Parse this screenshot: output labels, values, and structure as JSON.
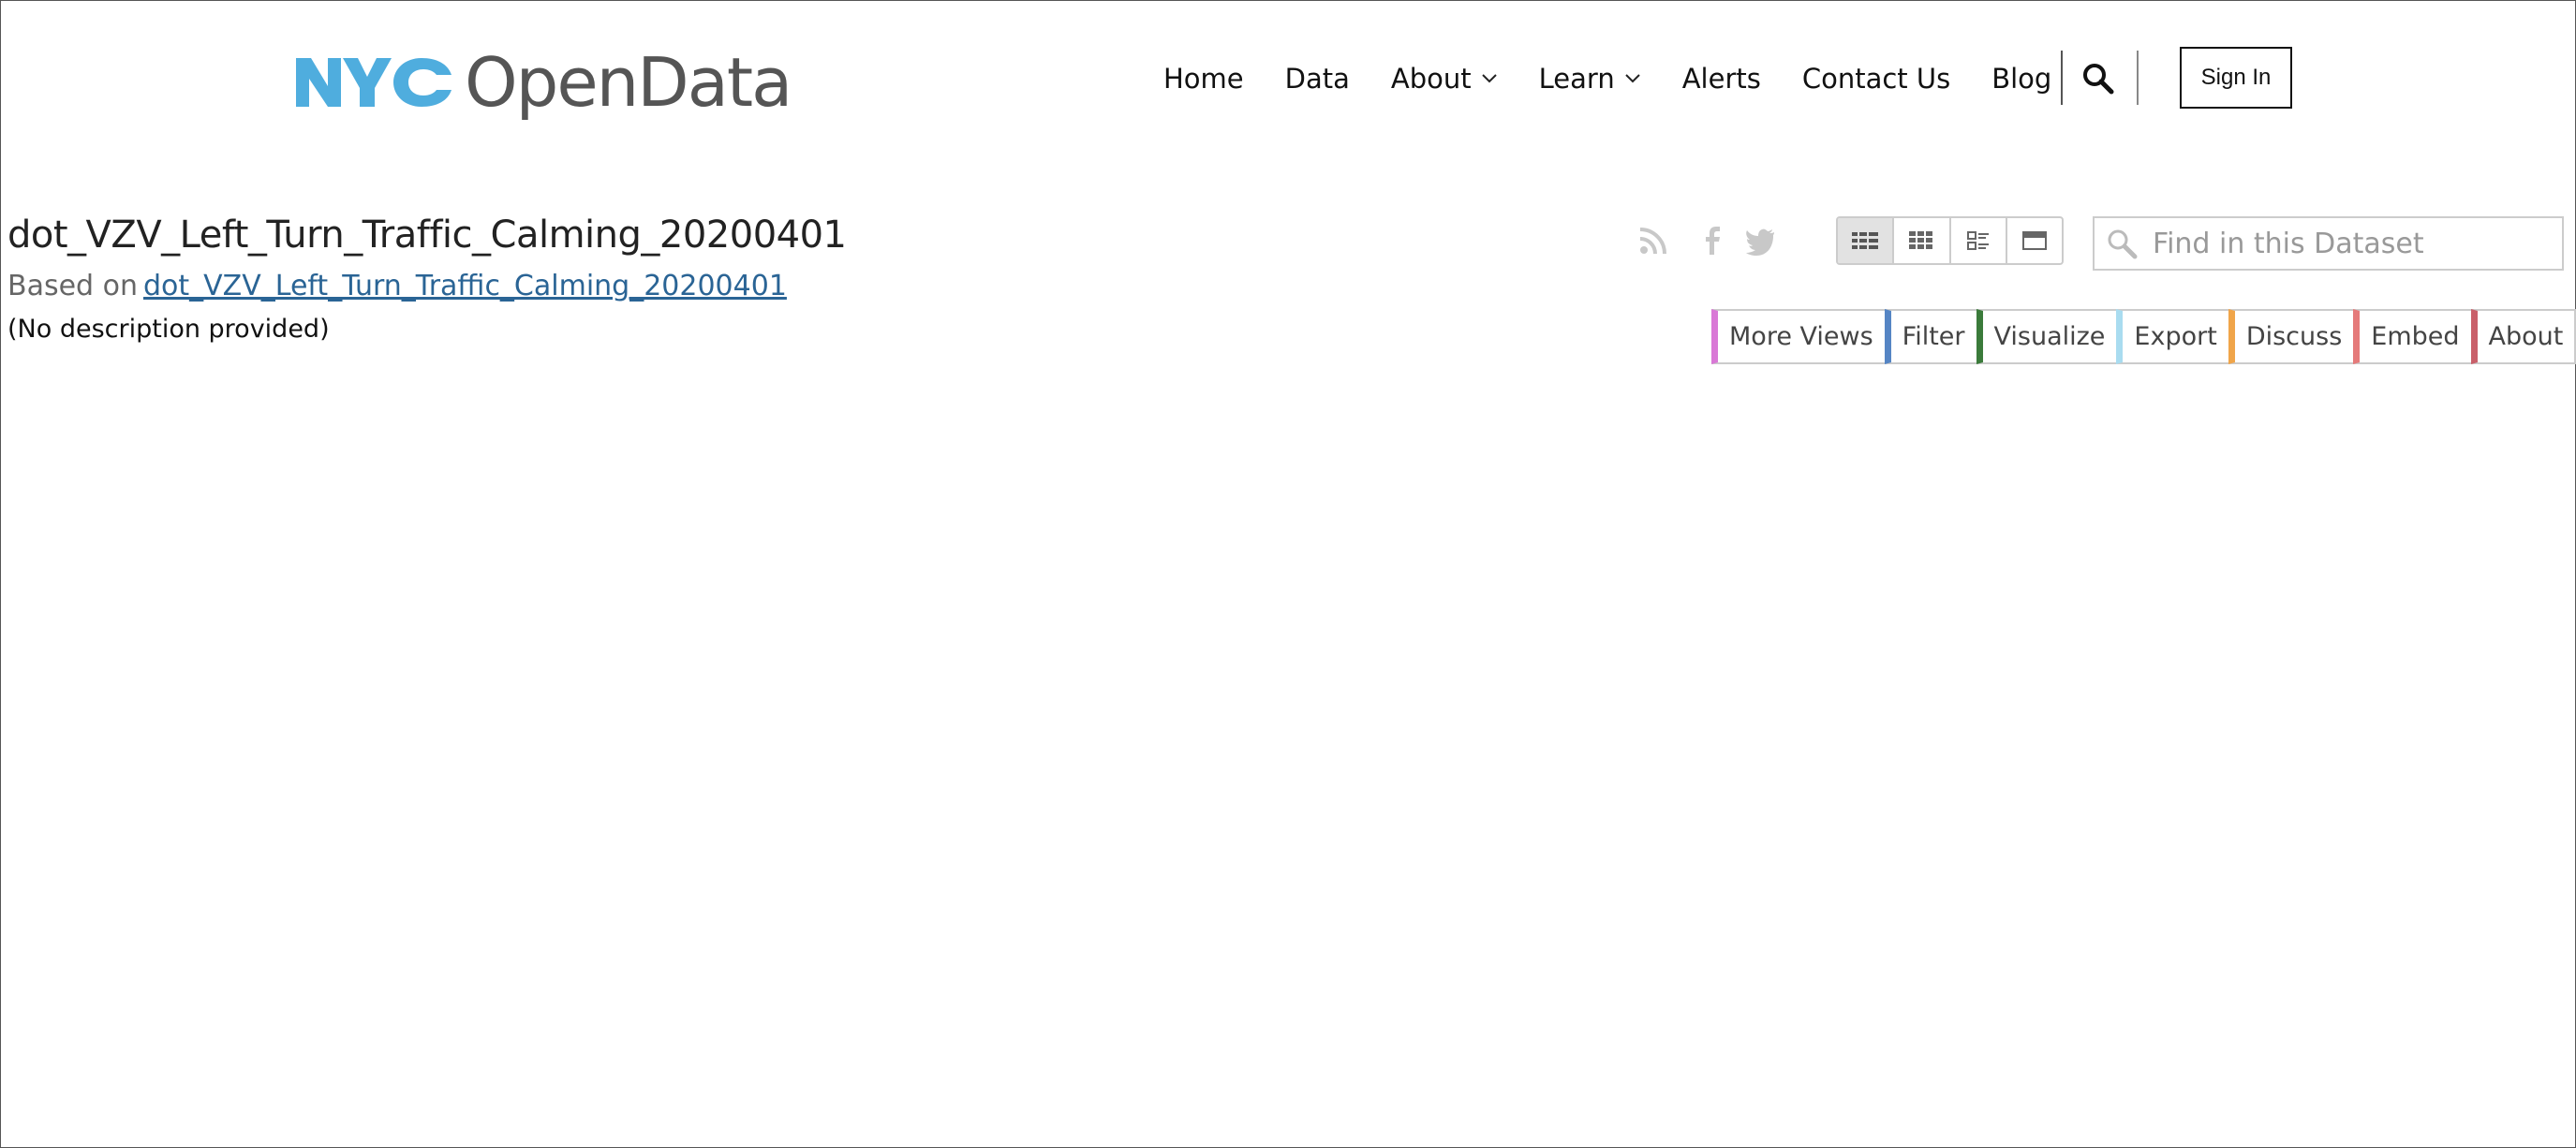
{
  "header": {
    "logo": {
      "mark_text": "NYC",
      "wordmark": "OpenData",
      "mark_color": "#4fadde"
    },
    "nav": [
      {
        "label": "Home",
        "has_dropdown": false
      },
      {
        "label": "Data",
        "has_dropdown": false
      },
      {
        "label": "About",
        "has_dropdown": true
      },
      {
        "label": "Learn",
        "has_dropdown": true
      },
      {
        "label": "Alerts",
        "has_dropdown": false
      },
      {
        "label": "Contact Us",
        "has_dropdown": false
      },
      {
        "label": "Blog",
        "has_dropdown": false
      }
    ],
    "search_icon": "search-icon",
    "sign_in_label": "Sign In"
  },
  "dataset": {
    "title": "dot_VZV_Left_Turn_Traffic_Calming_20200401",
    "based_on_prefix": "Based on",
    "based_on_link": "dot_VZV_Left_Turn_Traffic_Calming_20200401",
    "description": "(No description provided)"
  },
  "social_icons": [
    "rss-icon",
    "facebook-icon",
    "twitter-icon"
  ],
  "view_modes": [
    {
      "icon": "table-view-icon",
      "active": true
    },
    {
      "icon": "grid-view-icon",
      "active": false
    },
    {
      "icon": "list-view-icon",
      "active": false
    },
    {
      "icon": "page-view-icon",
      "active": false
    }
  ],
  "dataset_search": {
    "placeholder": "Find in this Dataset",
    "value": ""
  },
  "actions": [
    {
      "label": "More Views",
      "color": "#d978d6"
    },
    {
      "label": "Filter",
      "color": "#5585c4"
    },
    {
      "label": "Visualize",
      "color": "#3b7b3b"
    },
    {
      "label": "Export",
      "color": "#a9dcf0"
    },
    {
      "label": "Discuss",
      "color": "#f0a54a"
    },
    {
      "label": "Embed",
      "color": "#e57a7a"
    },
    {
      "label": "About",
      "color": "#c9606a"
    }
  ]
}
